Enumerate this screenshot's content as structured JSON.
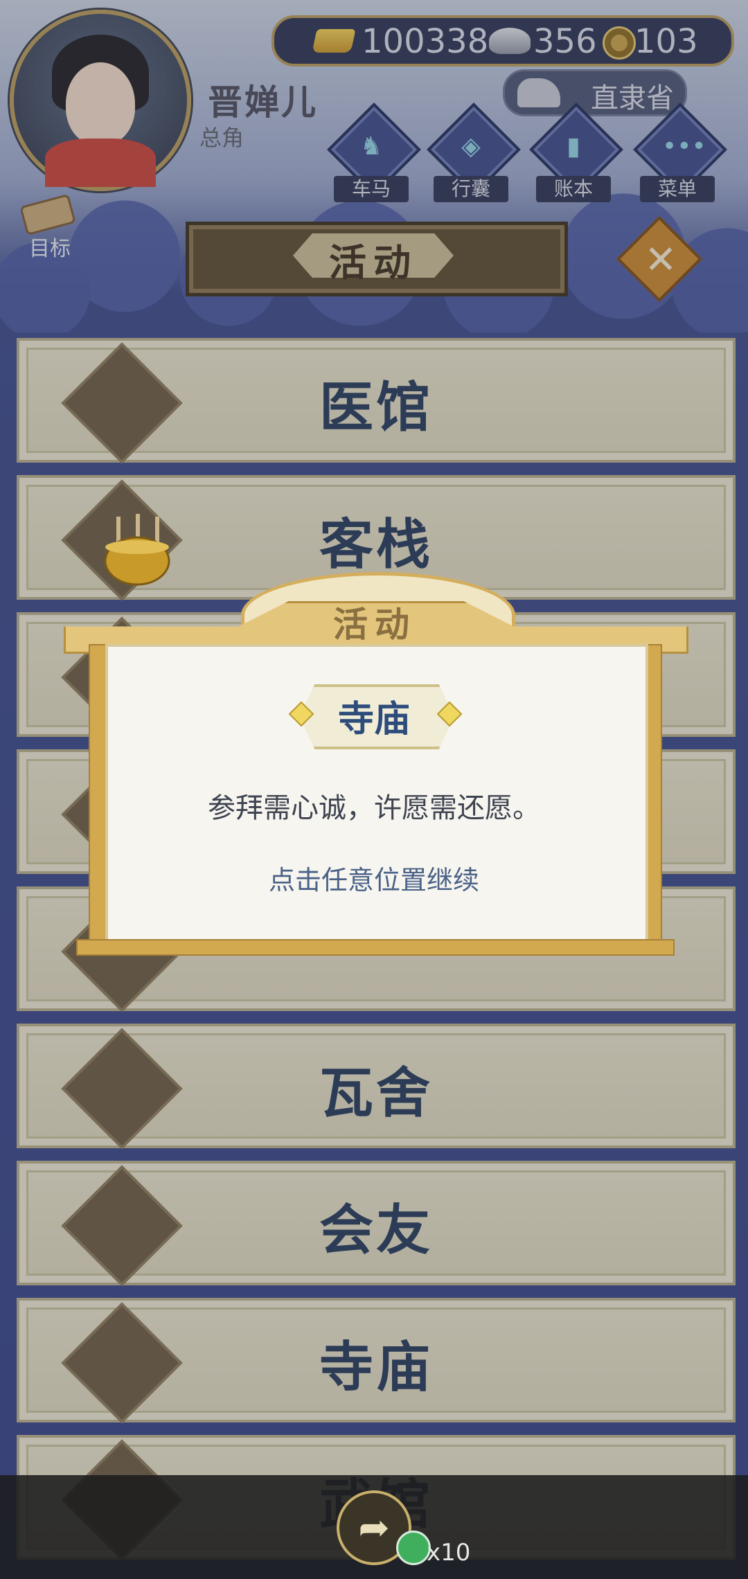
{
  "player": {
    "name": "晋婵儿",
    "role": "总角",
    "goal_label": "目标"
  },
  "currencies": {
    "gold": "100338",
    "silver": "356",
    "coins": "103"
  },
  "province": "直隶省",
  "hud_buttons": [
    {
      "label": "车马",
      "icon": "carriage-icon"
    },
    {
      "label": "行囊",
      "icon": "bag-icon"
    },
    {
      "label": "账本",
      "icon": "ledger-icon"
    },
    {
      "label": "菜单",
      "icon": "menu-dots-icon"
    }
  ],
  "screen_title": "活动",
  "activities": [
    {
      "label": "医馆",
      "icon": "ginseng-icon"
    },
    {
      "label": "客栈",
      "icon": "inn-door-icon"
    },
    {
      "label": "",
      "icon": "activity-3-icon"
    },
    {
      "label": "",
      "icon": "activity-4-icon"
    },
    {
      "label": "",
      "icon": "activity-5-icon"
    },
    {
      "label": "瓦舍",
      "icon": "performer-icon"
    },
    {
      "label": "会友",
      "icon": "tea-bowl-icon"
    },
    {
      "label": "寺庙",
      "icon": "censer-icon"
    },
    {
      "label": "武馆",
      "icon": "dojo-gate-icon"
    }
  ],
  "modal": {
    "title": "活动",
    "place": "寺庙",
    "description": "参拜需心诚，许愿需还愿。",
    "hint": "点击任意位置继续"
  },
  "share": {
    "count": "x10"
  },
  "colors": {
    "accent_gold": "#d2a94e",
    "label_blue": "#243a5e"
  }
}
